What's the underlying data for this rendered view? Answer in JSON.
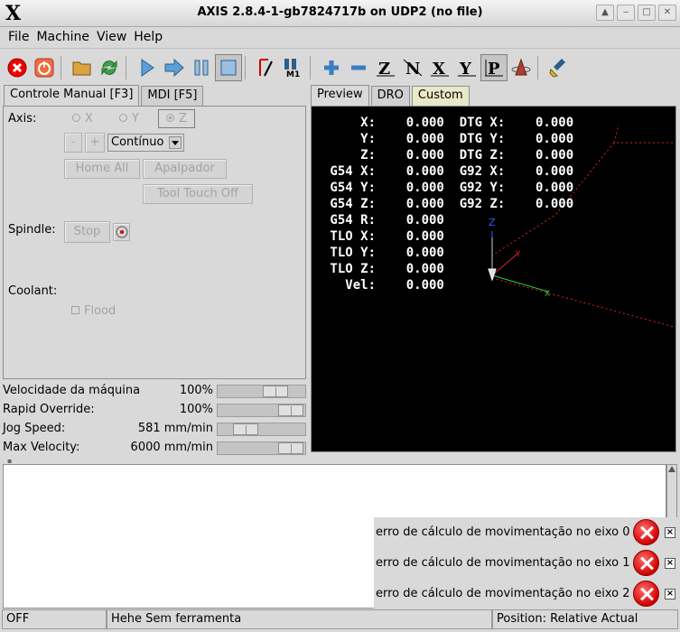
{
  "window": {
    "title": "AXIS 2.8.4-1-gb7824717b on UDP2 (no file)",
    "logo": "X",
    "buttons": [
      "up-icon",
      "minimize-icon",
      "maximize-icon",
      "close-icon"
    ]
  },
  "menu": [
    {
      "label": "File"
    },
    {
      "label": "Machine"
    },
    {
      "label": "View"
    },
    {
      "label": "Help"
    }
  ],
  "toolbar": {
    "icons": [
      "estop-icon",
      "power-icon",
      "open-file-icon",
      "reload-icon",
      "run-icon",
      "step-icon",
      "pause-icon",
      "stop-icon",
      "block-delete-icon",
      "optional-stop-icon",
      "zoom-in-icon",
      "zoom-out-icon",
      "view-z-icon",
      "view-z2-icon",
      "view-x-icon",
      "view-y-icon",
      "view-p-icon",
      "rotate-view-icon",
      "clear-plot-icon"
    ]
  },
  "left_tabs": [
    {
      "label": "Controle Manual [F3]",
      "active": true
    },
    {
      "label": "MDI [F5]",
      "active": false
    }
  ],
  "manual": {
    "axis_label": "Axis:",
    "axes": [
      "X",
      "Y",
      "Z"
    ],
    "selected_axis": "Z",
    "minus": "-",
    "plus": "+",
    "jog_mode": "Contínuo",
    "home_all": "Home All",
    "apalpador": "Apalpador",
    "tool_touch_off": "Tool Touch Off",
    "spindle_label": "Spindle:",
    "spindle_stop": "Stop",
    "coolant_label": "Coolant:",
    "flood": "Flood"
  },
  "sliders": [
    {
      "name": "Velocidade da máquina",
      "value": "100%",
      "fraction": 0.75
    },
    {
      "name": "Rapid Override:",
      "value": "100%",
      "fraction": 1.0
    },
    {
      "name": "Jog Speed:",
      "value": "581 mm/min",
      "fraction": 0.25
    },
    {
      "name": "Max Velocity:",
      "value": "6000 mm/min",
      "fraction": 1.0
    }
  ],
  "right_tabs": [
    {
      "label": "Preview",
      "active": true
    },
    {
      "label": "DRO",
      "active": false
    },
    {
      "label": "Custom",
      "active": false
    }
  ],
  "dro": [
    "     X:    0.000  DTG X:    0.000",
    "     Y:    0.000  DTG Y:    0.000",
    "     Z:    0.000  DTG Z:    0.000",
    " G54 X:    0.000  G92 X:    0.000",
    " G54 Y:    0.000  G92 Y:    0.000",
    " G54 Z:    0.000  G92 Z:    0.000",
    " G54 R:    0.000",
    " TLO X:    0.000",
    " TLO Y:    0.000",
    " TLO Z:    0.000",
    "   Vel:    0.000"
  ],
  "preview_axes": {
    "z_label": "Z",
    "x_label": "X",
    "y_label": "Y"
  },
  "notifications": [
    {
      "message": "erro de cálculo de movimentação no eixo 0"
    },
    {
      "message": "erro de cálculo de movimentação no eixo 1"
    },
    {
      "message": "erro de cálculo de movimentação no eixo 2"
    }
  ],
  "status": {
    "state": "OFF",
    "tool": "Hehe Sem ferramenta",
    "position": "Position: Relative Actual"
  },
  "colors": {
    "background": "#d9d9d9",
    "preview_bg": "#000000",
    "error_red": "#d40000",
    "custom_tab": "#e9e9c9"
  }
}
